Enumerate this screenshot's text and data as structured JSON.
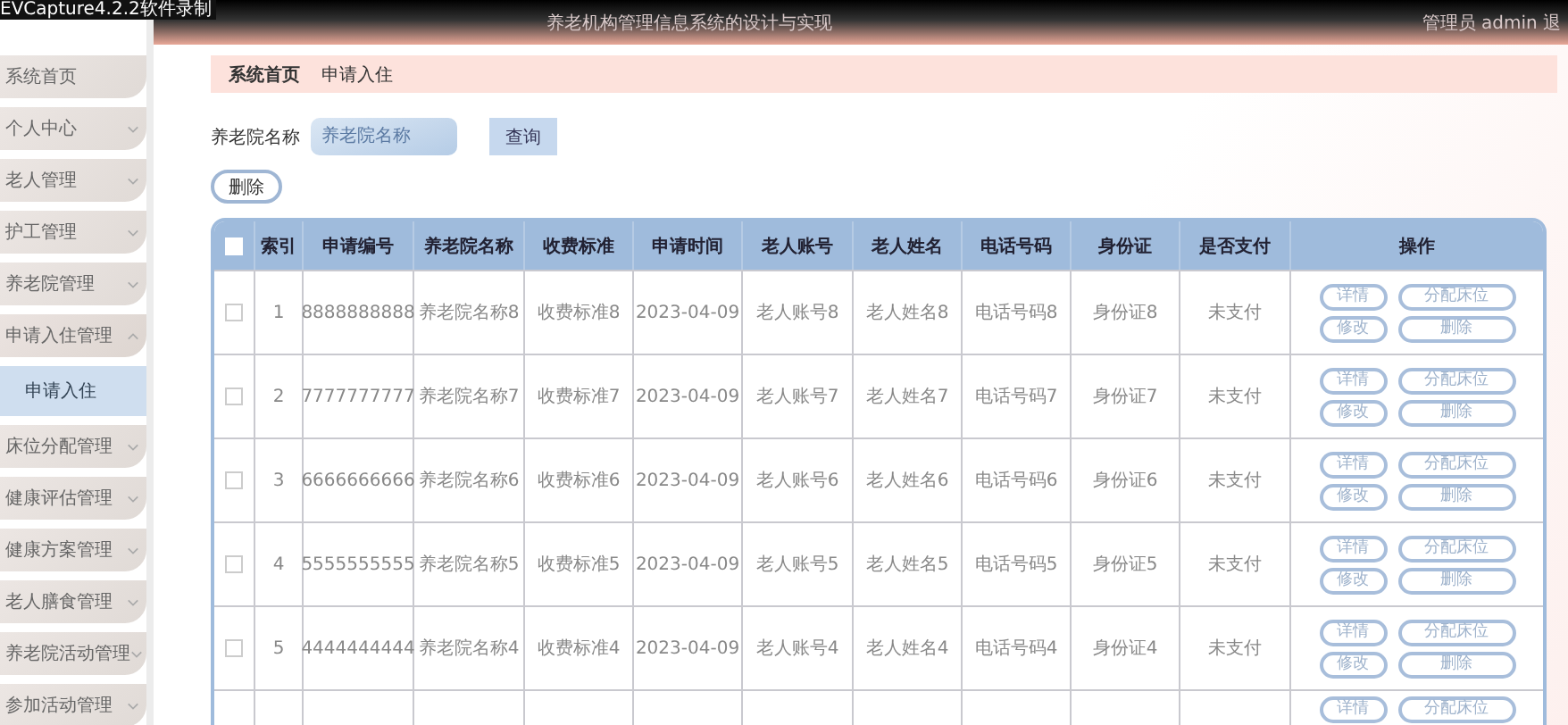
{
  "recorder_label": "EVCapture4.2.2软件录制",
  "header": {
    "title": "养老机构管理信息系统的设计与实现",
    "user": "管理员 admin 退"
  },
  "sidebar": {
    "items": [
      {
        "label": "系统首页"
      },
      {
        "label": "个人中心",
        "expanded": false
      },
      {
        "label": "老人管理",
        "expanded": false
      },
      {
        "label": "护工管理",
        "expanded": false
      },
      {
        "label": "养老院管理",
        "expanded": false
      },
      {
        "label": "申请入住管理",
        "expanded": true,
        "children": [
          {
            "label": "申请入住",
            "selected": true
          }
        ]
      },
      {
        "label": "床位分配管理",
        "expanded": false
      },
      {
        "label": "健康评估管理",
        "expanded": false
      },
      {
        "label": "健康方案管理",
        "expanded": false
      },
      {
        "label": "老人膳食管理",
        "expanded": false
      },
      {
        "label": "养老院活动管理",
        "expanded": false
      },
      {
        "label": "参加活动管理",
        "expanded": false
      }
    ]
  },
  "breadcrumb": [
    "系统首页",
    "申请入住"
  ],
  "search": {
    "label": "养老院名称",
    "placeholder": "养老院名称",
    "button": "查询"
  },
  "delete_button": "删除",
  "table": {
    "select_all_checked": false,
    "columns": [
      "索引",
      "申请编号",
      "养老院名称",
      "收费标准",
      "申请时间",
      "老人账号",
      "老人姓名",
      "电话号码",
      "身份证",
      "是否支付",
      "操作"
    ],
    "rows": [
      {
        "checked": false,
        "cells": [
          "1",
          "8888888888",
          "养老院名称8",
          "收费标准8",
          "2023-04-09",
          "老人账号8",
          "老人姓名8",
          "电话号码8",
          "身份证8",
          "未支付"
        ],
        "actions": [
          "详情",
          "分配床位",
          "修改",
          "删除"
        ]
      },
      {
        "checked": false,
        "cells": [
          "2",
          "7777777777",
          "养老院名称7",
          "收费标准7",
          "2023-04-09",
          "老人账号7",
          "老人姓名7",
          "电话号码7",
          "身份证7",
          "未支付"
        ],
        "actions": [
          "详情",
          "分配床位",
          "修改",
          "删除"
        ]
      },
      {
        "checked": false,
        "cells": [
          "3",
          "6666666666",
          "养老院名称6",
          "收费标准6",
          "2023-04-09",
          "老人账号6",
          "老人姓名6",
          "电话号码6",
          "身份证6",
          "未支付"
        ],
        "actions": [
          "详情",
          "分配床位",
          "修改",
          "删除"
        ]
      },
      {
        "checked": false,
        "cells": [
          "4",
          "5555555555",
          "养老院名称5",
          "收费标准5",
          "2023-04-09",
          "老人账号5",
          "老人姓名5",
          "电话号码5",
          "身份证5",
          "未支付"
        ],
        "actions": [
          "详情",
          "分配床位",
          "修改",
          "删除"
        ]
      },
      {
        "checked": false,
        "cells": [
          "5",
          "4444444444",
          "养老院名称4",
          "收费标准4",
          "2023-04-09",
          "老人账号4",
          "老人姓名4",
          "电话号码4",
          "身份证4",
          "未支付"
        ],
        "actions": [
          "详情",
          "分配床位",
          "修改",
          "删除"
        ]
      },
      {
        "cells": [],
        "actions": [
          "详情",
          "分配床位"
        ]
      }
    ]
  }
}
